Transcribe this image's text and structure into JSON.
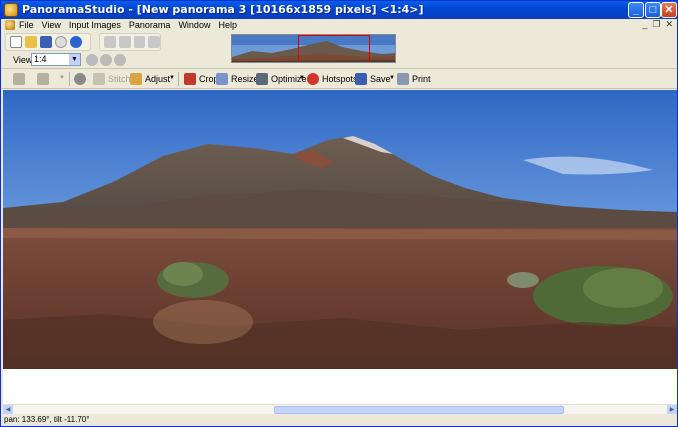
{
  "window": {
    "title": "PanoramaStudio - [New panorama 3 [10166x1859 pixels] <1:4>]",
    "controls": {
      "minimize": "_",
      "maximize": "□",
      "close": "✕"
    }
  },
  "menu": {
    "items": [
      "File",
      "View",
      "Input Images",
      "Panorama",
      "Window",
      "Help"
    ],
    "mdi_controls": [
      "_",
      "❐",
      "✕"
    ]
  },
  "view": {
    "label": "View:",
    "zoom_value": "1:4"
  },
  "toolbar": {
    "stitch": "Stitch",
    "adjust": "Adjust",
    "crop": "Crop",
    "resize": "Resize",
    "optimize": "Optimize",
    "hotspots": "Hotspots",
    "save": "Save",
    "print": "Print"
  },
  "status": {
    "text": "pan: 133.69°, tilt -11.70°"
  },
  "colors": {
    "titlebar": "#0046d5",
    "chrome": "#ece9d8",
    "selection": "#e00000",
    "scroll_thumb": "#c4d5fc"
  }
}
